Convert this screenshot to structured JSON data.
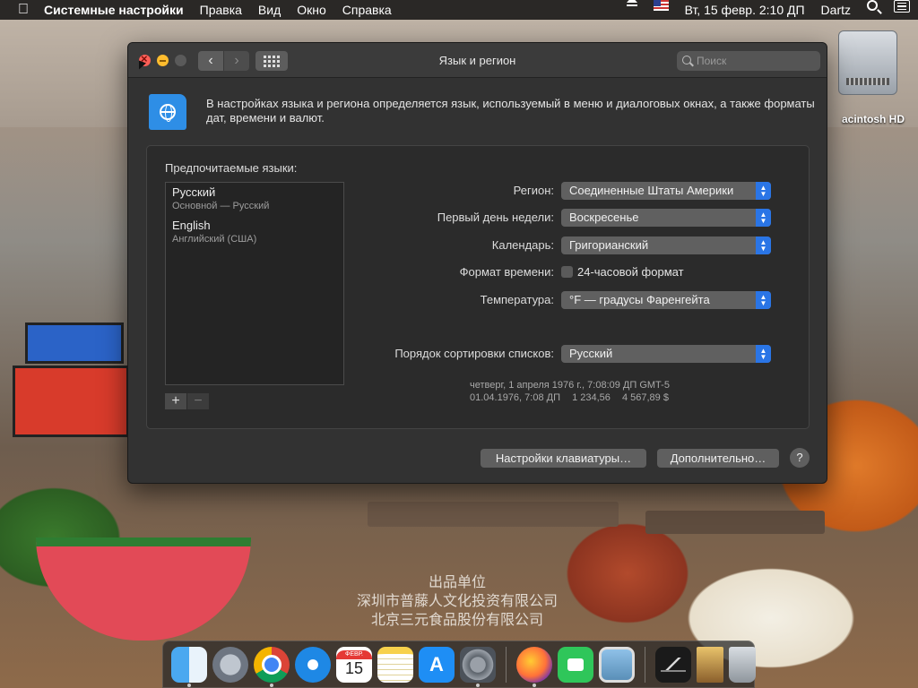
{
  "menubar": {
    "app_name": "Системные настройки",
    "menus": [
      "Правка",
      "Вид",
      "Окно",
      "Справка"
    ],
    "datetime": "Вт, 15 февр.  2:10 ДП",
    "user": "Dartz"
  },
  "desktop": {
    "disk_label": "acintosh HD",
    "wallpaper_text": [
      "出品单位",
      "深圳市普藤人文化投资有限公司",
      "北京三元食品股份有限公司"
    ]
  },
  "window": {
    "title": "Язык и регион",
    "search_placeholder": "Поиск",
    "description": "В настройках языка и региона определяется язык, используемый в меню и диалоговых окнах, а также форматы дат, времени и валют.",
    "preferred_languages_title": "Предпочитаемые языки:",
    "languages": [
      {
        "name": "Русский",
        "sub": "Основной — Русский"
      },
      {
        "name": "English",
        "sub": "Английский (США)"
      }
    ],
    "add_label": "+",
    "remove_label": "−",
    "settings": {
      "region": {
        "label": "Регион:",
        "value": "Соединенные Штаты Америки"
      },
      "first_day": {
        "label": "Первый день недели:",
        "value": "Воскресенье"
      },
      "calendar": {
        "label": "Календарь:",
        "value": "Григорианский"
      },
      "time_format": {
        "label": "Формат времени:",
        "checkbox_label": "24-часовой формат",
        "checked": false
      },
      "temperature": {
        "label": "Температура:",
        "value": "°F — градусы Фаренгейта"
      },
      "sort_order": {
        "label": "Порядок сортировки списков:",
        "value": "Русский"
      }
    },
    "sample": {
      "line1": "четверг, 1 апреля 1976 г., 7:08:09 ДП GMT-5",
      "date_short": "01.04.1976, 7:08 ДП",
      "number": "1 234,56",
      "currency": "4 567,89 $"
    },
    "buttons": {
      "keyboard": "Настройки клавиатуры…",
      "advanced": "Дополнительно…",
      "help": "?"
    }
  },
  "dock": {
    "calendar_month": "ФЕВР.",
    "calendar_day": "15",
    "items": [
      "finder",
      "launchpad",
      "chrome",
      "safari",
      "calendar",
      "notes",
      "app-store",
      "system-preferences",
      "firefox",
      "facetime",
      "preview",
      "stocks",
      "book",
      "trash"
    ]
  }
}
